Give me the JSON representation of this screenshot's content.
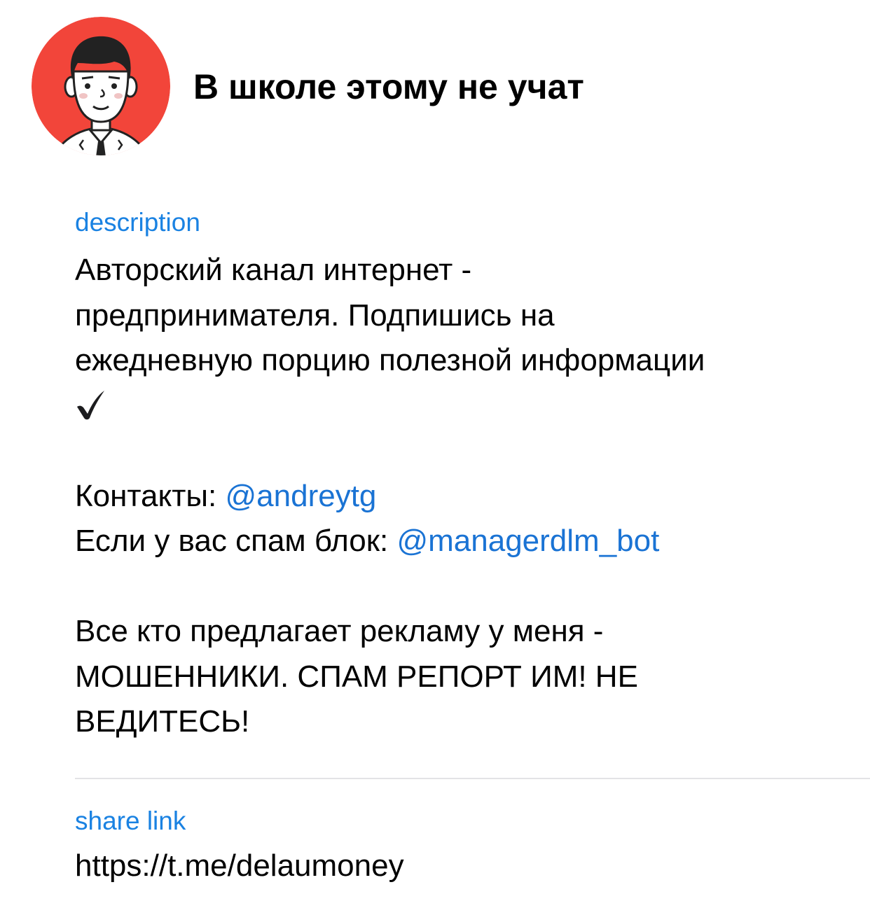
{
  "header": {
    "title": "В школе этому не учат",
    "avatar_icon": "man-in-tie-avatar-icon",
    "avatar_bg": "#f2453a"
  },
  "description": {
    "label": "description",
    "line1": "Авторский канал интернет -",
    "line2": "предпринимателя. Подпишись на",
    "line3": "ежедневную порцию полезной информации",
    "check_icon": "check-mark-icon",
    "contacts_prefix": "Контакты: ",
    "contacts_mention": "@andreytg",
    "spam_prefix": "Если у вас спам блок: ",
    "spam_mention": "@managerdlm_bot",
    "warning_line1": "Все кто предлагает рекламу у меня -",
    "warning_line2": "МОШЕННИКИ. СПАМ РЕПОРТ ИМ! НЕ",
    "warning_line3": "ВЕДИТЕСЬ!"
  },
  "share": {
    "label": "share link",
    "url": "https://t.me/delaumoney"
  },
  "colors": {
    "accent_label": "#1a82e2",
    "mention": "#1a73d4",
    "divider": "#e3e3e6"
  }
}
